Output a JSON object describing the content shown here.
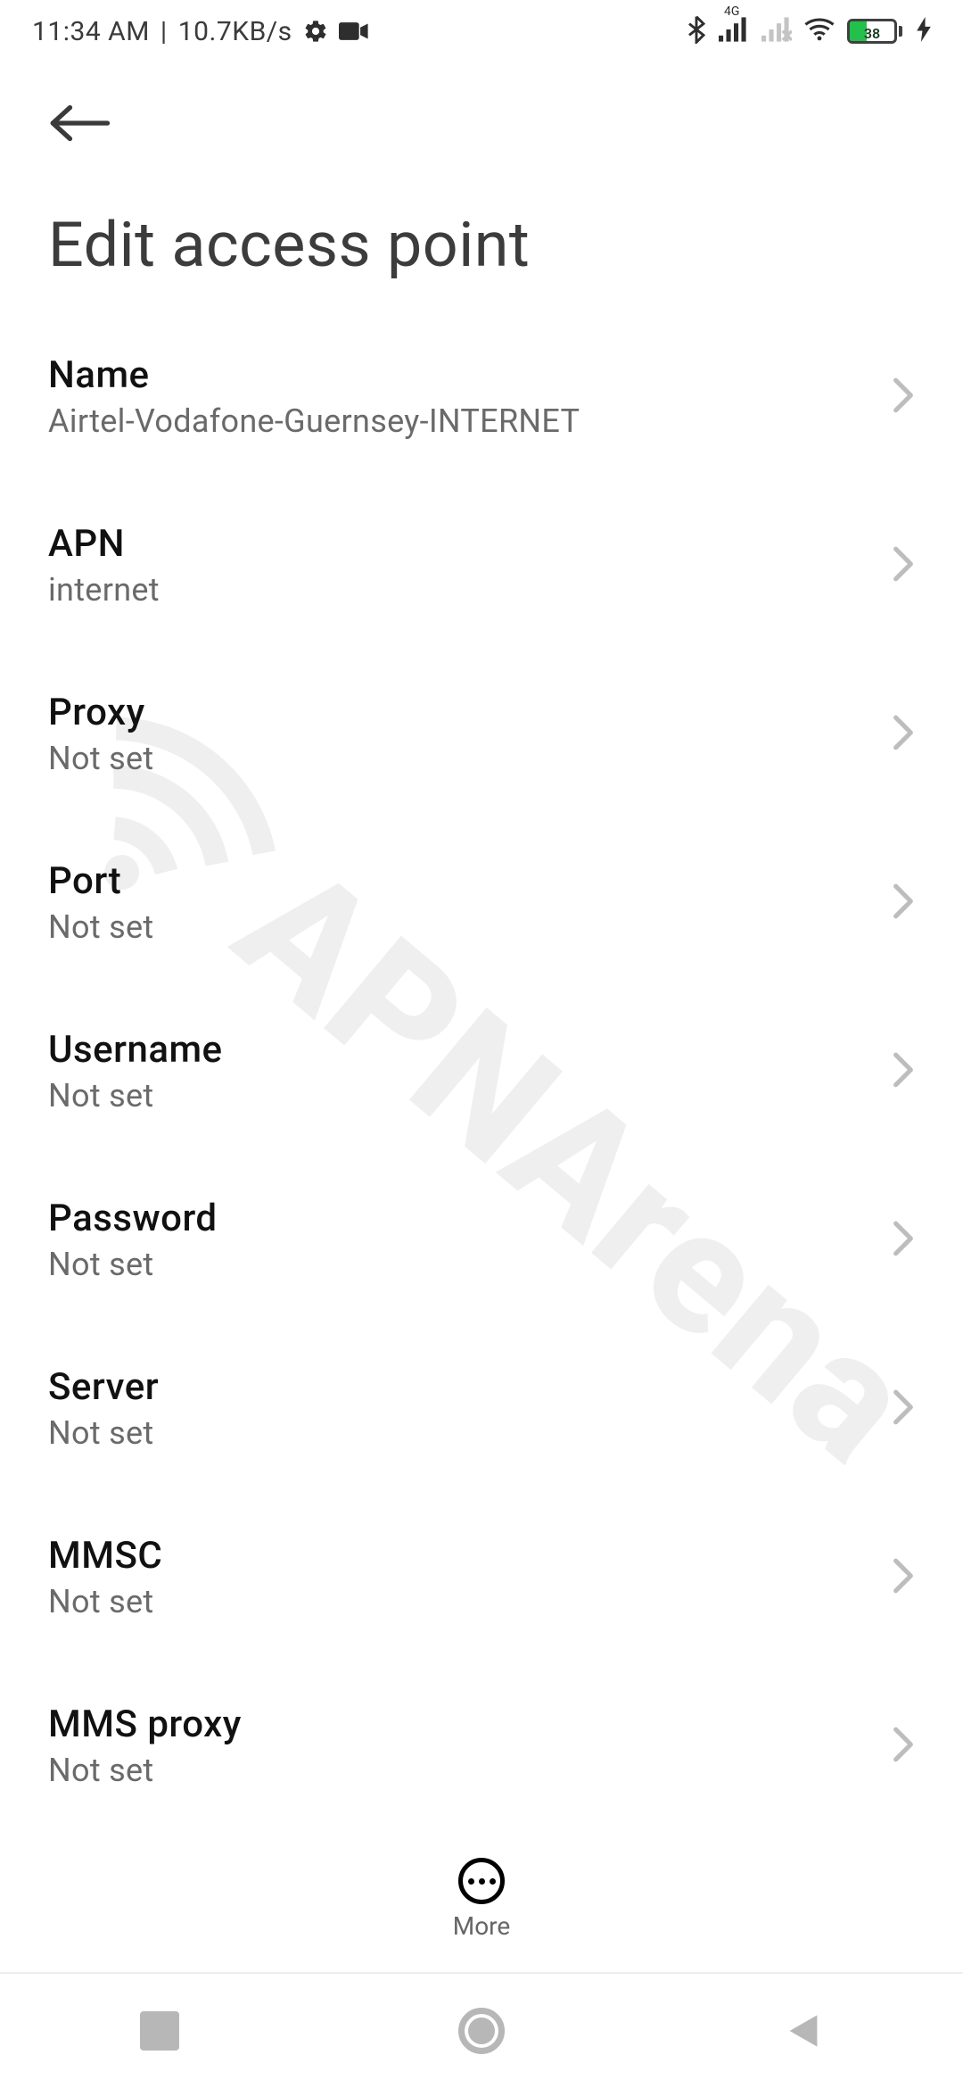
{
  "statusbar": {
    "time": "11:34 AM",
    "speed": "10.7KB/s",
    "network_label": "4G",
    "battery_pct": "38"
  },
  "header": {
    "title": "Edit access point"
  },
  "settings": {
    "items": [
      {
        "label": "Name",
        "value": "Airtel-Vodafone-Guernsey-INTERNET"
      },
      {
        "label": "APN",
        "value": "internet"
      },
      {
        "label": "Proxy",
        "value": "Not set"
      },
      {
        "label": "Port",
        "value": "Not set"
      },
      {
        "label": "Username",
        "value": "Not set"
      },
      {
        "label": "Password",
        "value": "Not set"
      },
      {
        "label": "Server",
        "value": "Not set"
      },
      {
        "label": "MMSC",
        "value": "Not set"
      },
      {
        "label": "MMS proxy",
        "value": "Not set"
      }
    ]
  },
  "more_button": {
    "label": "More"
  },
  "watermark": {
    "text": "APNArena"
  }
}
